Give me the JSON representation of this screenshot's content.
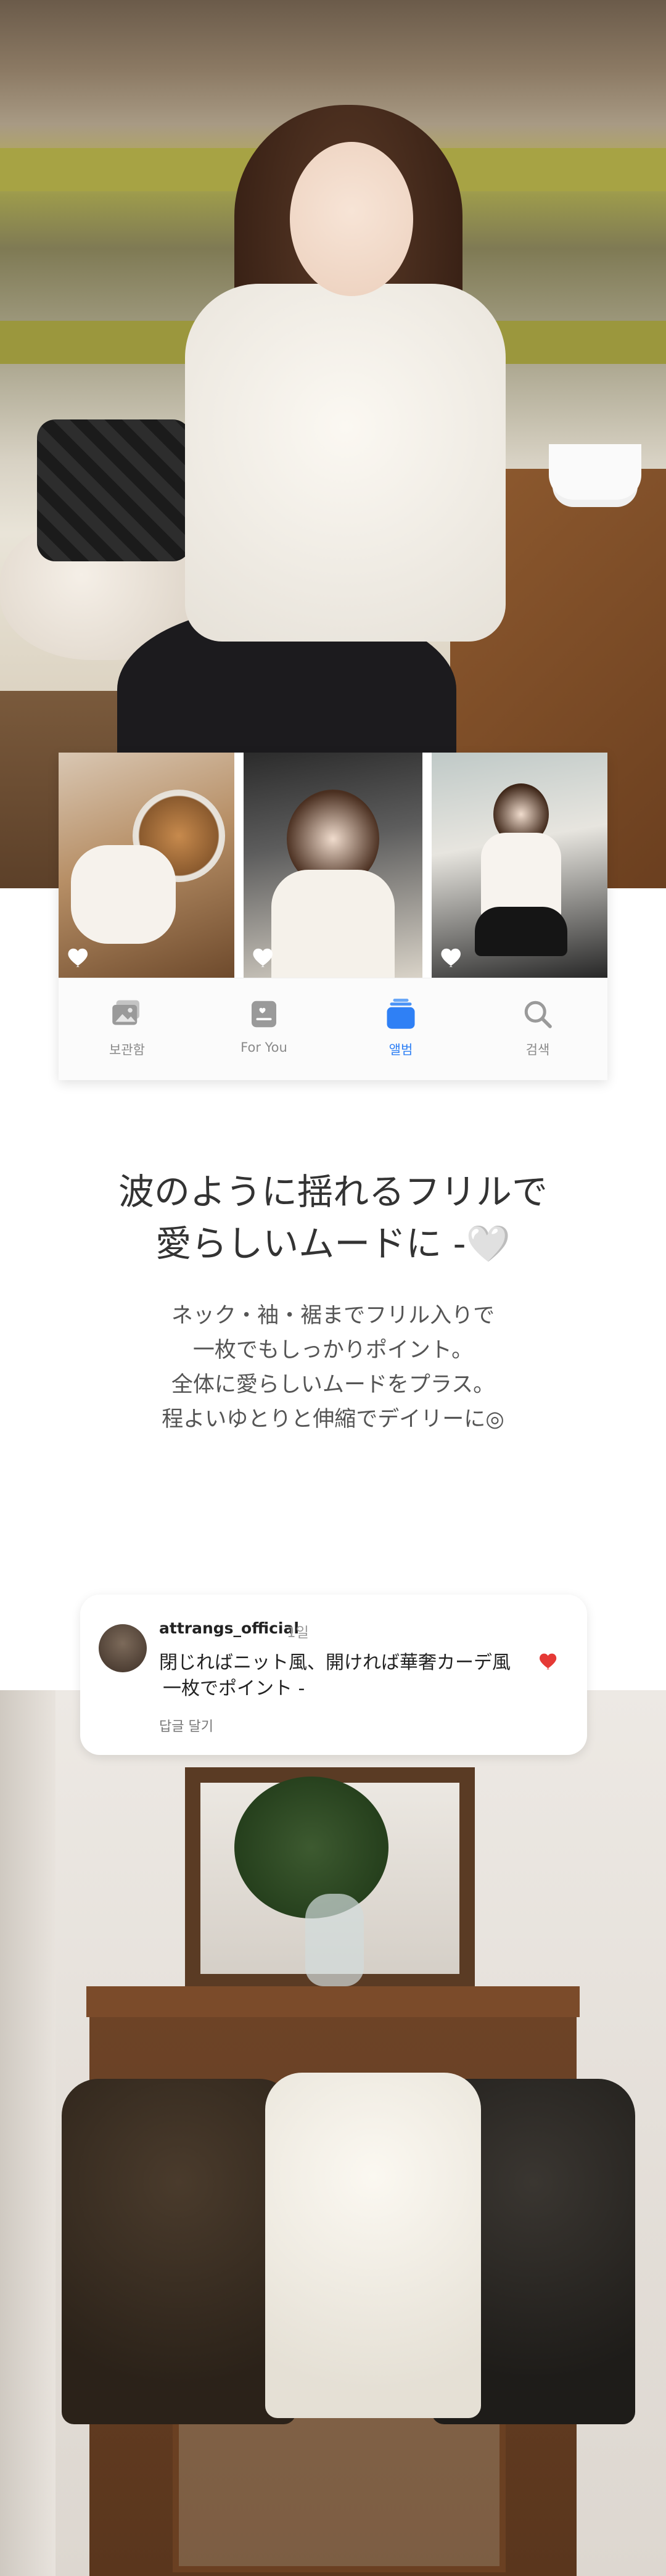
{
  "album": {
    "nav": [
      {
        "label": "보관함",
        "icon": "photo-library-icon"
      },
      {
        "label": "For You",
        "icon": "for-you-icon"
      },
      {
        "label": "앨범",
        "icon": "album-icon"
      },
      {
        "label": "검색",
        "icon": "search-icon"
      }
    ],
    "active_index": 2,
    "accent": "#2f80f5"
  },
  "headline": {
    "line1": "波のように揺れるフリルで",
    "line2": "愛らしいムードに -",
    "emoji": "🤍"
  },
  "body": {
    "lines": [
      "ネック・袖・裾までフリル入りで",
      "一枚でもしっかりポイント。",
      "全体に愛らしいムードをプラス。",
      "程よいゆとりと伸縮でデイリーに◎"
    ]
  },
  "comment": {
    "username": "attrangs_official",
    "time": "1일",
    "text_line1": "閉じればニット風、開ければ華奢カーデ風",
    "text_line2": "一枚でポイント -",
    "reply_label": "답글 달기",
    "heart_color": "#e53935"
  }
}
